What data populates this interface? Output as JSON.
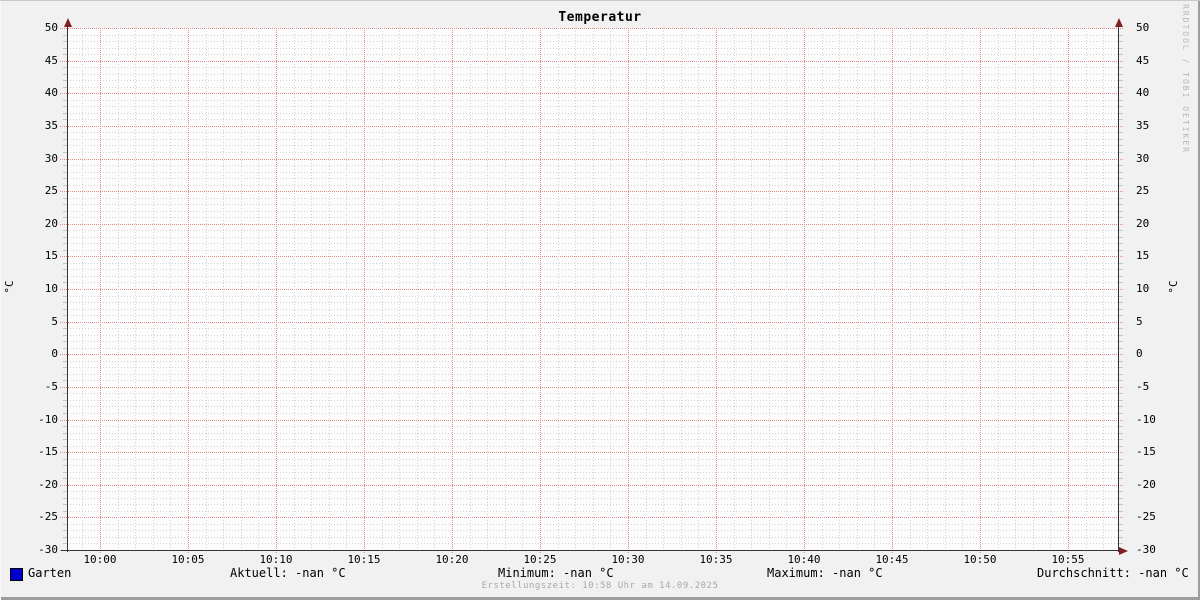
{
  "title": "Temperatur",
  "watermark": "RRDTOOL / TOBI OETIKER",
  "footer": {
    "text": "Erstellungszeit: 10:58 Uhr am 14.09.2025"
  },
  "axes": {
    "y_label_left": "°C",
    "y_label_right": "°C",
    "y_ticks": [
      "50",
      "45",
      "40",
      "35",
      "30",
      "25",
      "20",
      "15",
      "10",
      "5",
      "0",
      "-5",
      "-10",
      "-15",
      "-20",
      "-25",
      "-30"
    ],
    "x_ticks": [
      "10:00",
      "10:05",
      "10:10",
      "10:15",
      "10:20",
      "10:25",
      "10:30",
      "10:35",
      "10:40",
      "10:45",
      "10:50",
      "10:55"
    ]
  },
  "legend": {
    "series_label": "Garten",
    "swatch_color": "#0000cc",
    "stats": [
      {
        "label": "Aktuell",
        "value": "-nan °C"
      },
      {
        "label": "Minimum",
        "value": "-nan °C"
      },
      {
        "label": "Maximum",
        "value": "-nan °C"
      },
      {
        "label": "Durchschnitt",
        "value": "-nan °C"
      }
    ]
  },
  "colors": {
    "background": "#f1f1f1",
    "canvas": "#fcfcfc",
    "major_grid": "#e98888",
    "minor_grid": "#d2d2d2",
    "axis": "#333333",
    "arrow": "#7f2020",
    "series_garten": "#0000cc",
    "footer_text": "#a8a8a8",
    "watermark_text": "#b8b8b8"
  },
  "chart_data": {
    "type": "line",
    "title": "Temperatur",
    "xlabel": "",
    "ylabel": "°C",
    "ylim": [
      -30,
      50
    ],
    "y_major_step": 5,
    "y_minor_step": 1,
    "x_tick_labels": [
      "10:00",
      "10:05",
      "10:10",
      "10:15",
      "10:20",
      "10:25",
      "10:30",
      "10:35",
      "10:40",
      "10:45",
      "10:50",
      "10:55"
    ],
    "x_major_step_minutes": 5,
    "x_minor_step_minutes": 1,
    "grid": true,
    "legend_position": "bottom",
    "series": [
      {
        "name": "Garten",
        "color": "#0000cc",
        "values": []
      }
    ],
    "stats": {
      "Aktuell": "-nan °C",
      "Minimum": "-nan °C",
      "Maximum": "-nan °C",
      "Durchschnitt": "-nan °C"
    }
  }
}
